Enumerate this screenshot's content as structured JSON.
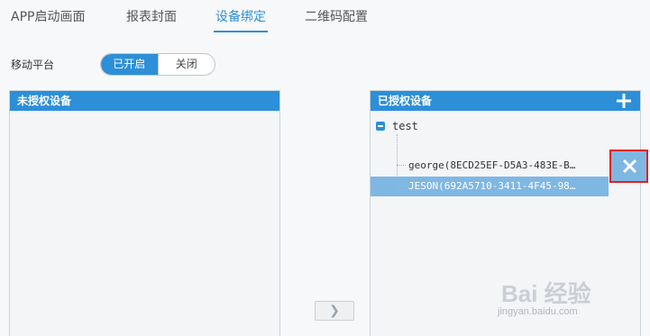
{
  "tabs": [
    {
      "label": "APP启动画面",
      "active": false
    },
    {
      "label": "报表封面",
      "active": false
    },
    {
      "label": "设备绑定",
      "active": true
    },
    {
      "label": "二维码配置",
      "active": false
    }
  ],
  "platform": {
    "label": "移动平台",
    "toggle_on": "已开启",
    "toggle_off": "关闭",
    "state": "on"
  },
  "unauthorized_panel": {
    "title": "未授权设备"
  },
  "authorized_panel": {
    "title": "已授权设备",
    "add_icon": "plus-icon",
    "tree": {
      "root": "test",
      "items": [
        {
          "label": "george(8ECD25EF-D5A3-483E-B…",
          "selected": false
        },
        {
          "label": "JESON(692A5710-3411-4F45-98…",
          "selected": true
        }
      ]
    },
    "delete_icon": "close-icon"
  },
  "move_button": {
    "label": "❯"
  },
  "watermark": {
    "main": "Bai 经验",
    "sub": "jingyan.baidu.com"
  },
  "colors": {
    "accent": "#2c8fd8",
    "selected_row": "#7fb7e3",
    "highlight_box": "#e02020"
  }
}
